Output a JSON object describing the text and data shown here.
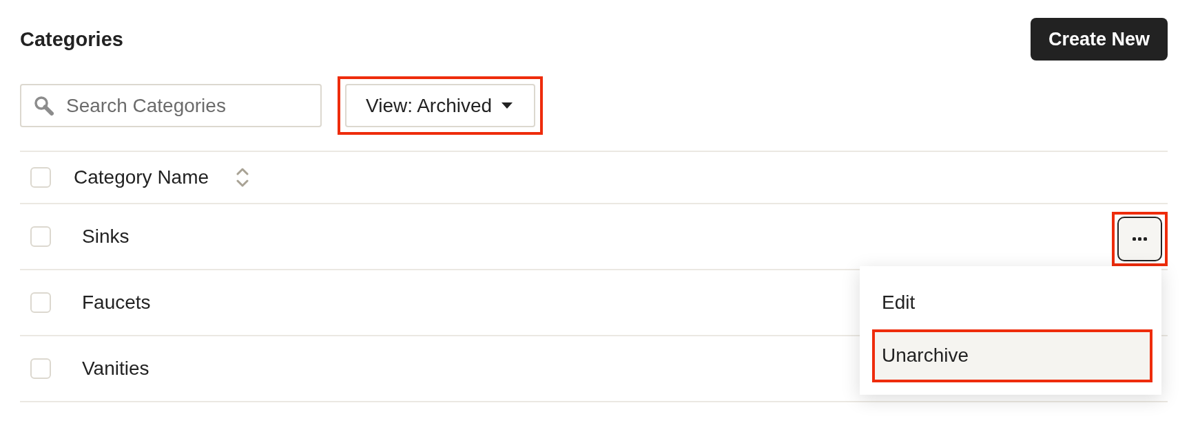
{
  "page": {
    "title": "Categories"
  },
  "create_button": {
    "label": "Create New"
  },
  "toolbar": {
    "search": {
      "placeholder": "Search Categories"
    },
    "view_filter": {
      "label": "View: Archived",
      "highlighted": true
    }
  },
  "table": {
    "header": {
      "checked": false,
      "columns": [
        {
          "label": "Category Name",
          "sortable": true
        }
      ]
    },
    "rows": [
      {
        "name": "Sinks",
        "checked": false,
        "actions": {
          "expanded": true,
          "highlighted": true,
          "menu": {
            "items": [
              {
                "label": "Edit",
                "selected": false,
                "highlighted": false
              },
              {
                "label": "Unarchive",
                "selected": true,
                "highlighted": true
              }
            ]
          }
        }
      },
      {
        "name": "Faucets",
        "checked": false
      },
      {
        "name": "Vanities",
        "checked": false
      }
    ]
  }
}
